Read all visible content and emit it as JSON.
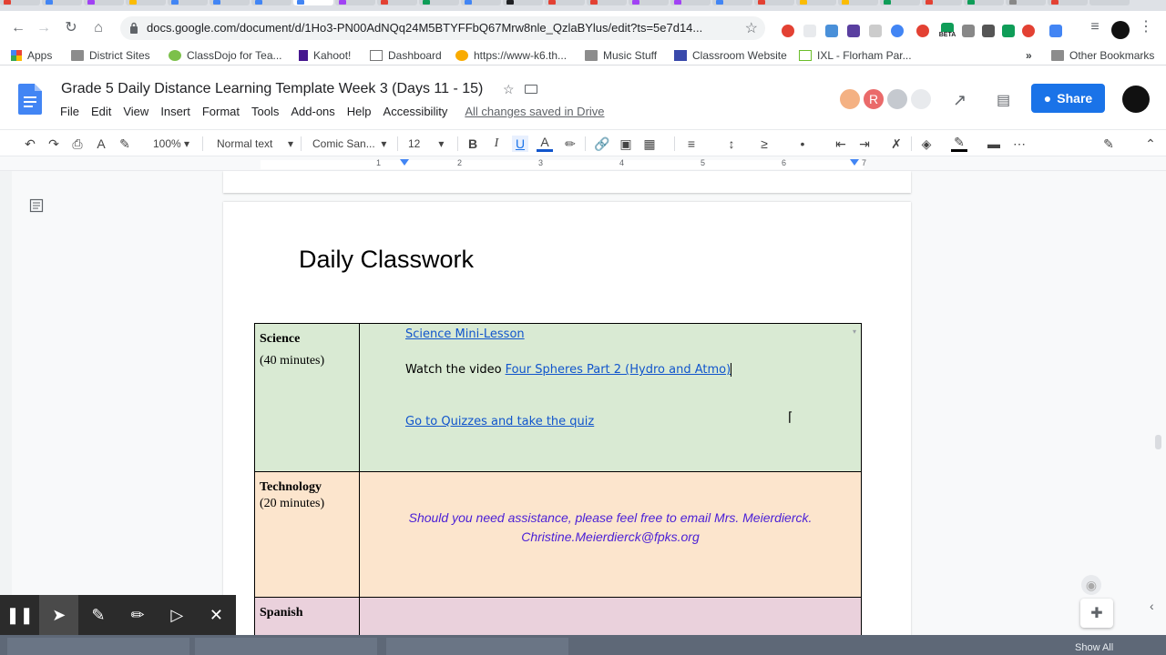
{
  "browser": {
    "url": "docs.google.com/document/d/1Ho3-PN00AdNQq24M5BTYFFbQ67Mrw8nle_QzlaBYlus/edit?ts=5e7d14...",
    "extension_badge": "BETA",
    "bookmarks": [
      "Apps",
      "District Sites",
      "ClassDojo for Tea...",
      "Kahoot!",
      "Dashboard",
      "https://www-k6.th...",
      "Music Stuff",
      "Classroom Website",
      "IXL - Florham Par..."
    ],
    "bookmarks_overflow": "»",
    "other_bookmarks": "Other Bookmarks"
  },
  "doc": {
    "title": "Grade 5 Daily Distance Learning Template Week 3 (Days 11 - 15)",
    "menu": [
      "File",
      "Edit",
      "View",
      "Insert",
      "Format",
      "Tools",
      "Add-ons",
      "Help",
      "Accessibility"
    ],
    "save_status": "All changes saved in Drive",
    "share_label": "Share",
    "collaborator_initial": "R"
  },
  "toolbar": {
    "zoom": "100%",
    "style": "Normal text",
    "font": "Comic San...",
    "size": "12"
  },
  "ruler": {
    "numbers": [
      "1",
      "1",
      "2",
      "3",
      "4",
      "5",
      "6",
      "7"
    ]
  },
  "content": {
    "heading": "Daily Classwork",
    "rows": [
      {
        "subject": "Science",
        "duration": "(40 minutes)",
        "link1": "Science Mini-Lesson",
        "watch_prefix": "Watch the video",
        "link2": "Four Spheres Part 2 (Hydro and Atmo)",
        "link3": "Go to Quizzes and take the quiz"
      },
      {
        "subject": "Technology",
        "duration": "(20 minutes)",
        "assist_line1": "Should you need assistance, please feel free to email Mrs. Meierdierck.",
        "assist_line2": "Christine.Meierdierck@fpks.org"
      },
      {
        "subject": "Spanish"
      }
    ]
  },
  "downloads": {
    "show_all": "Show All"
  },
  "colors": {
    "science_bg": "#d9ead3",
    "technology_bg": "#fce5cd",
    "spanish_bg": "#ead1dc",
    "share_blue": "#1a73e8",
    "link_blue": "#1155cc"
  }
}
